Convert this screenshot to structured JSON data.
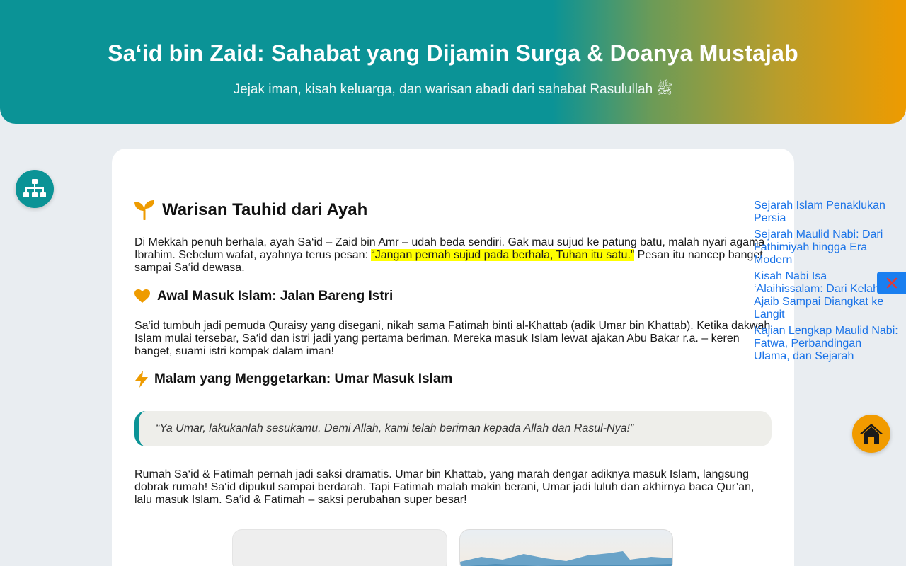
{
  "header": {
    "title": "Sa‘id bin Zaid: Sahabat yang Dijamin Surga & Doanya Mustajab",
    "subtitle": "Jejak iman, kisah keluarga, dan warisan abadi dari sahabat Rasulullah ﷺ"
  },
  "article": {
    "section1": {
      "icon": "sprout-icon",
      "title": "Warisan Tauhid dari Ayah",
      "para_before": "Di Mekkah penuh berhala, ayah Sa‘id – Zaid bin Amr – udah beda sendiri. Gak mau sujud ke patung batu, malah nyari agama Ibrahim. Sebelum wafat, ayahnya terus pesan: ",
      "para_highlight": "“Jangan pernah sujud pada berhala, Tuhan itu satu.”",
      "para_after": " Pesan itu nancep banget sampai Sa‘id dewasa."
    },
    "section2": {
      "icon": "heart-icon",
      "title": "Awal Masuk Islam: Jalan Bareng Istri",
      "para": "Sa‘id tumbuh jadi pemuda Quraisy yang disegani, nikah sama Fatimah binti al-Khattab (adik Umar bin Khattab). Ketika dakwah Islam mulai tersebar, Sa‘id dan istri jadi yang pertama beriman. Mereka masuk Islam lewat ajakan Abu Bakar r.a. – keren banget, suami istri kompak dalam iman!"
    },
    "section3": {
      "icon": "lightning-icon",
      "title": "Malam yang Menggetarkan: Umar Masuk Islam",
      "quote": "“Ya Umar, lakukanlah sesukamu. Demi Allah, kami telah beriman kepada Allah dan Rasul-Nya!”",
      "para": "Rumah Sa‘id & Fatimah pernah jadi saksi dramatis. Umar bin Khattab, yang marah dengar adiknya masuk Islam, langsung dobrak rumah! Sa‘id dipukul sampai berdarah. Tapi Fatimah malah makin berani, Umar jadi luluh dan akhirnya baca Qur’an, lalu masuk Islam. Sa‘id & Fatimah – saksi perubahan super besar!"
    }
  },
  "related_links": [
    "Sejarah Islam Penaklukan Persia",
    "Sejarah Maulid Nabi: Dari Fathimiyah hingga Era Modern",
    "Kisah Nabi Isa ‘Alaihissalam: Dari Kelahiran Ajaib Sampai Diangkat ke Langit",
    "Kajian Lengkap Maulid Nabi: Fatwa, Perbandingan Ulama, dan Sejarah"
  ],
  "buttons": {
    "sitemap": "sitemap-icon",
    "home": "home-icon",
    "close": "close-icon"
  },
  "colors": {
    "primary": "#0b9396",
    "accent": "#ee9b00",
    "link": "#1a73e8",
    "highlight": "#ffff00",
    "close_button": "#1a7ff0",
    "close_icon": "#e53935"
  }
}
